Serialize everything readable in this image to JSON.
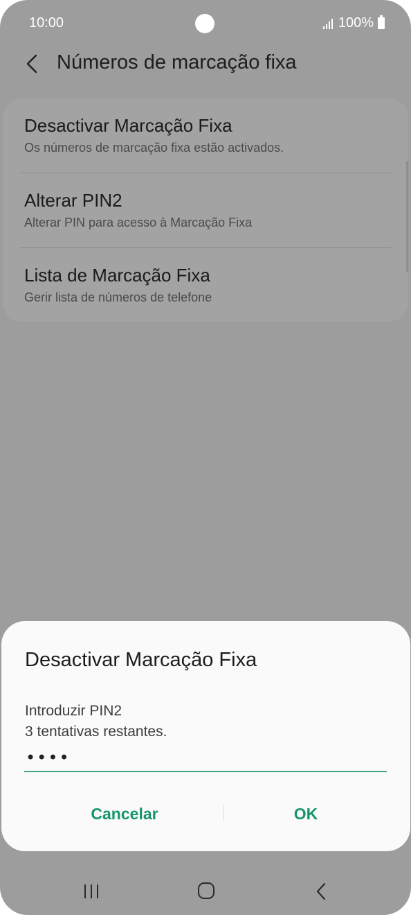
{
  "status_bar": {
    "time": "10:00",
    "battery": "100%"
  },
  "header": {
    "title": "Números de marcação fixa"
  },
  "settings": {
    "items": [
      {
        "title": "Desactivar Marcação Fixa",
        "subtitle": "Os números de marcação fixa estão activados."
      },
      {
        "title": "Alterar PIN2",
        "subtitle": "Alterar PIN para acesso à Marcação Fixa"
      },
      {
        "title": "Lista de Marcação Fixa",
        "subtitle": "Gerir lista de números de telefone"
      }
    ]
  },
  "dialog": {
    "title": "Desactivar Marcação Fixa",
    "label": "Introduzir PIN2",
    "attempts": "3 tentativas restantes.",
    "pin_value": "••••",
    "cancel_label": "Cancelar",
    "ok_label": "OK"
  },
  "colors": {
    "accent": "#17966a",
    "scrim": "#9d9d9d",
    "dialog_bg": "#fafafa"
  },
  "icons": {
    "back": "chevron-left-icon",
    "recent": "recent-apps-icon",
    "home": "home-icon",
    "nav_back": "nav-back-icon"
  }
}
